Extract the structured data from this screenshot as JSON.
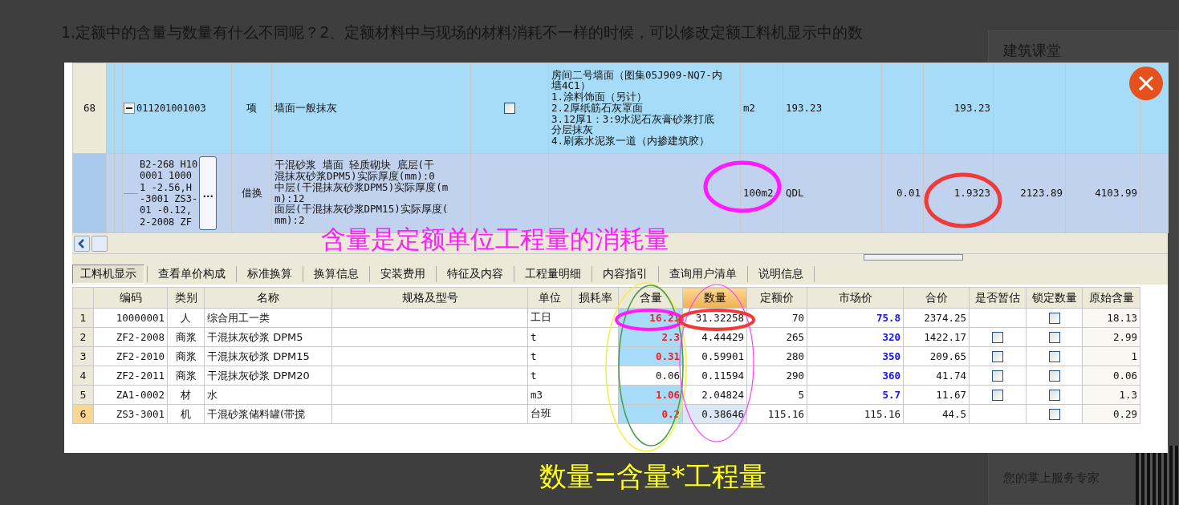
{
  "page": {
    "question": "1.定额中的含量与数量有什么不同呢？2、定额材料中与现场的材料消耗不一样的时候，可以修改定额工料机显示中的数",
    "sidebar": {
      "title": "建筑课堂",
      "subtitle": "您的掌上服务专家"
    }
  },
  "viewer": {
    "upper_grid": {
      "rows": [
        {
          "kind": "item",
          "selected": false,
          "row_number": "68",
          "expanded": true,
          "code": [
            "011201001003"
          ],
          "type": "项",
          "name": [
            "墙面一般抹灰"
          ],
          "checked": false,
          "description": [
            "房间二号墙面（图集05J909-NQ7-内",
            "墙4C1）",
            "1.涂料饰面（另计）",
            "2.2厚纸筋石灰罩面",
            "3.12厚1：3:9水泥石灰膏砂浆打底",
            "分层抹灰",
            "4.刷素水泥浆一道（内掺建筑胶）"
          ],
          "unit": "m2",
          "column_9": "193.23",
          "column_11": "193.23"
        },
        {
          "kind": "sub",
          "selected": true,
          "code": [
            "B2-268 H10",
            "0001 1000",
            "1 -2.56,H",
            "-3001 ZS3-",
            "01 -0.12,",
            "2-2008 ZF"
          ],
          "button": "…",
          "type": "借换",
          "name": [
            "干混砂浆 墙面 轻质砌块  底层(干",
            "混抹灰砂浆DPM5)实际厚度(mm):0",
            "中层(干混抹灰砂浆DPM5)实际厚度(m",
            "m):12",
            "面层(干混抹灰砂浆DPM15)实际厚度(",
            "mm):2"
          ],
          "unit": "100m2",
          "column_9": "QDL",
          "column_10": "0.01",
          "column_11": "1.9323",
          "column_12": "2123.89",
          "column_13": "4103.99"
        }
      ]
    },
    "annotation": "含量是定额单位工程量的消耗量",
    "tabs": [
      {
        "label": "工料机显示",
        "selected": true
      },
      {
        "label": "查看单价构成",
        "selected": false
      },
      {
        "label": "标准换算",
        "selected": false
      },
      {
        "label": "换算信息",
        "selected": false
      },
      {
        "label": "安装费用",
        "selected": false
      },
      {
        "label": "特征及内容",
        "selected": false
      },
      {
        "label": "工程量明细",
        "selected": false
      },
      {
        "label": "内容指引",
        "selected": false
      },
      {
        "label": "查询用户清单",
        "selected": false
      },
      {
        "label": "说明信息",
        "selected": false
      }
    ],
    "table": {
      "columns": [
        {
          "label": "编码",
          "sorted": false
        },
        {
          "label": "类别",
          "sorted": false
        },
        {
          "label": "名称",
          "sorted": false
        },
        {
          "label": "规格及型号",
          "sorted": false
        },
        {
          "label": "单位",
          "sorted": false
        },
        {
          "label": "损耗率",
          "sorted": false
        },
        {
          "label": "含量",
          "sorted": false
        },
        {
          "label": "数量",
          "sorted": true
        },
        {
          "label": "定额价",
          "sorted": false
        },
        {
          "label": "市场价",
          "sorted": false
        },
        {
          "label": "合价",
          "sorted": false
        },
        {
          "label": "是否暂估",
          "sorted": false
        },
        {
          "label": "锁定数量",
          "sorted": false
        },
        {
          "label": "原始含量",
          "sorted": false
        }
      ],
      "rows": [
        {
          "num": "1",
          "selected": false,
          "code": "10000001",
          "category": "人",
          "name": "综合用工一类",
          "unit": "工日",
          "content": "16.21",
          "content_modified": true,
          "quantity": "31.32258",
          "quota_price": "70",
          "market_price": "75.8",
          "market_modified": true,
          "total": "2374.25",
          "locked": false,
          "original_content": "18.13"
        },
        {
          "num": "2",
          "selected": false,
          "code": "ZF2-2008",
          "category": "商浆",
          "name": "干混抹灰砂浆 DPM5",
          "unit": "t",
          "content": "2.3",
          "content_modified": true,
          "quantity": "4.44429",
          "quota_price": "265",
          "market_price": "320",
          "market_modified": true,
          "total": "1422.17",
          "estimate": false,
          "locked": false,
          "original_content": "2.99"
        },
        {
          "num": "3",
          "selected": false,
          "code": "ZF2-2010",
          "category": "商浆",
          "name": "干混抹灰砂浆 DPM15",
          "unit": "t",
          "content": "0.31",
          "content_modified": true,
          "quantity": "0.59901",
          "quota_price": "280",
          "market_price": "350",
          "market_modified": true,
          "total": "209.65",
          "estimate": false,
          "locked": false,
          "original_content": "1"
        },
        {
          "num": "4",
          "selected": false,
          "code": "ZF2-2011",
          "category": "商浆",
          "name": "干混抹灰砂浆 DPM20",
          "unit": "t",
          "content": "0.06",
          "content_modified": false,
          "quantity": "0.11594",
          "quota_price": "290",
          "market_price": "360",
          "market_modified": true,
          "total": "41.74",
          "estimate": false,
          "locked": false,
          "original_content": "0.06"
        },
        {
          "num": "5",
          "selected": false,
          "code": "ZA1-0002",
          "category": "材",
          "name": "水",
          "unit": "m3",
          "content": "1.06",
          "content_modified": true,
          "quantity": "2.04824",
          "quota_price": "5",
          "market_price": "5.7",
          "market_modified": true,
          "total": "11.67",
          "estimate": false,
          "locked": false,
          "original_content": "1.3"
        },
        {
          "num": "6",
          "selected": true,
          "code": "ZS3-3001",
          "category": "机",
          "name": "干混砂浆储料罐(带搅",
          "unit": "台班",
          "content": "0.2",
          "content_modified": true,
          "quantity": "0.38646",
          "quota_price": "115.16",
          "market_price": "115.16",
          "market_modified": false,
          "total": "44.5",
          "locked": false,
          "original_content": "0.29"
        }
      ]
    }
  },
  "caption": "数量=含量*工程量"
}
